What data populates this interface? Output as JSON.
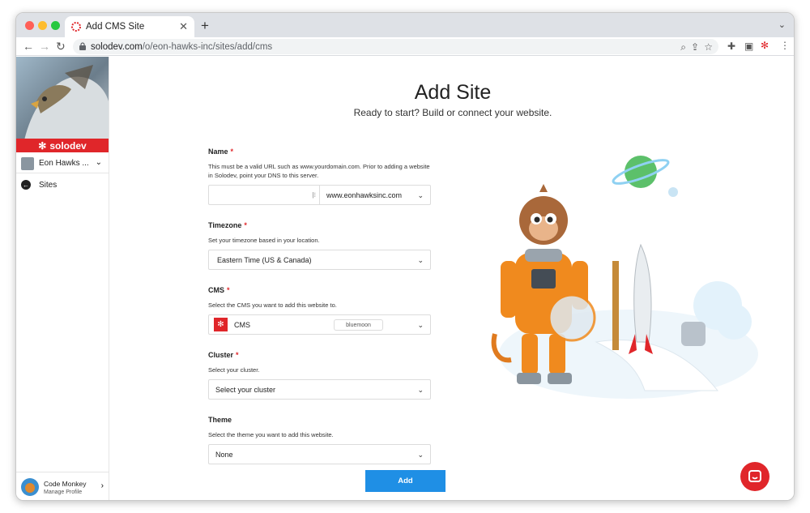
{
  "browser": {
    "tab_title": "Add CMS Site",
    "url_domain": "solodev.com",
    "url_path": "/o/eon-hawks-inc/sites/add/cms"
  },
  "sidebar": {
    "brand": "solodev",
    "org_name": "Eon Hawks ...",
    "nav_sites": "Sites",
    "profile_name": "Code Monkey",
    "profile_sub": "Manage Profile"
  },
  "page": {
    "title": "Add Site",
    "subtitle": "Ready to start? Build or connect your website."
  },
  "form": {
    "name_label": "Name",
    "name_help": "This must be a valid URL such as www.yourdomain.com. Prior to adding a website in Solodev, point your DNS to this server.",
    "name_value": "",
    "domain_value": "www.eonhawksinc.com",
    "timezone_label": "Timezone",
    "timezone_help": "Set your timezone based in your location.",
    "timezone_value": "Eastern Time (US & Canada)",
    "cms_label": "CMS",
    "cms_help": "Select the CMS you want to add this website to.",
    "cms_value": "CMS",
    "cms_badge": "bluemoon",
    "cluster_label": "Cluster",
    "cluster_help": "Select your cluster.",
    "cluster_value": "Select your cluster",
    "theme_label": "Theme",
    "theme_help": "Select the theme you want to add this website.",
    "theme_value": "None",
    "required_mark": "*",
    "add_button": "Add"
  },
  "colors": {
    "brand_red": "#e0262a",
    "button_blue": "#1f8fe5"
  }
}
